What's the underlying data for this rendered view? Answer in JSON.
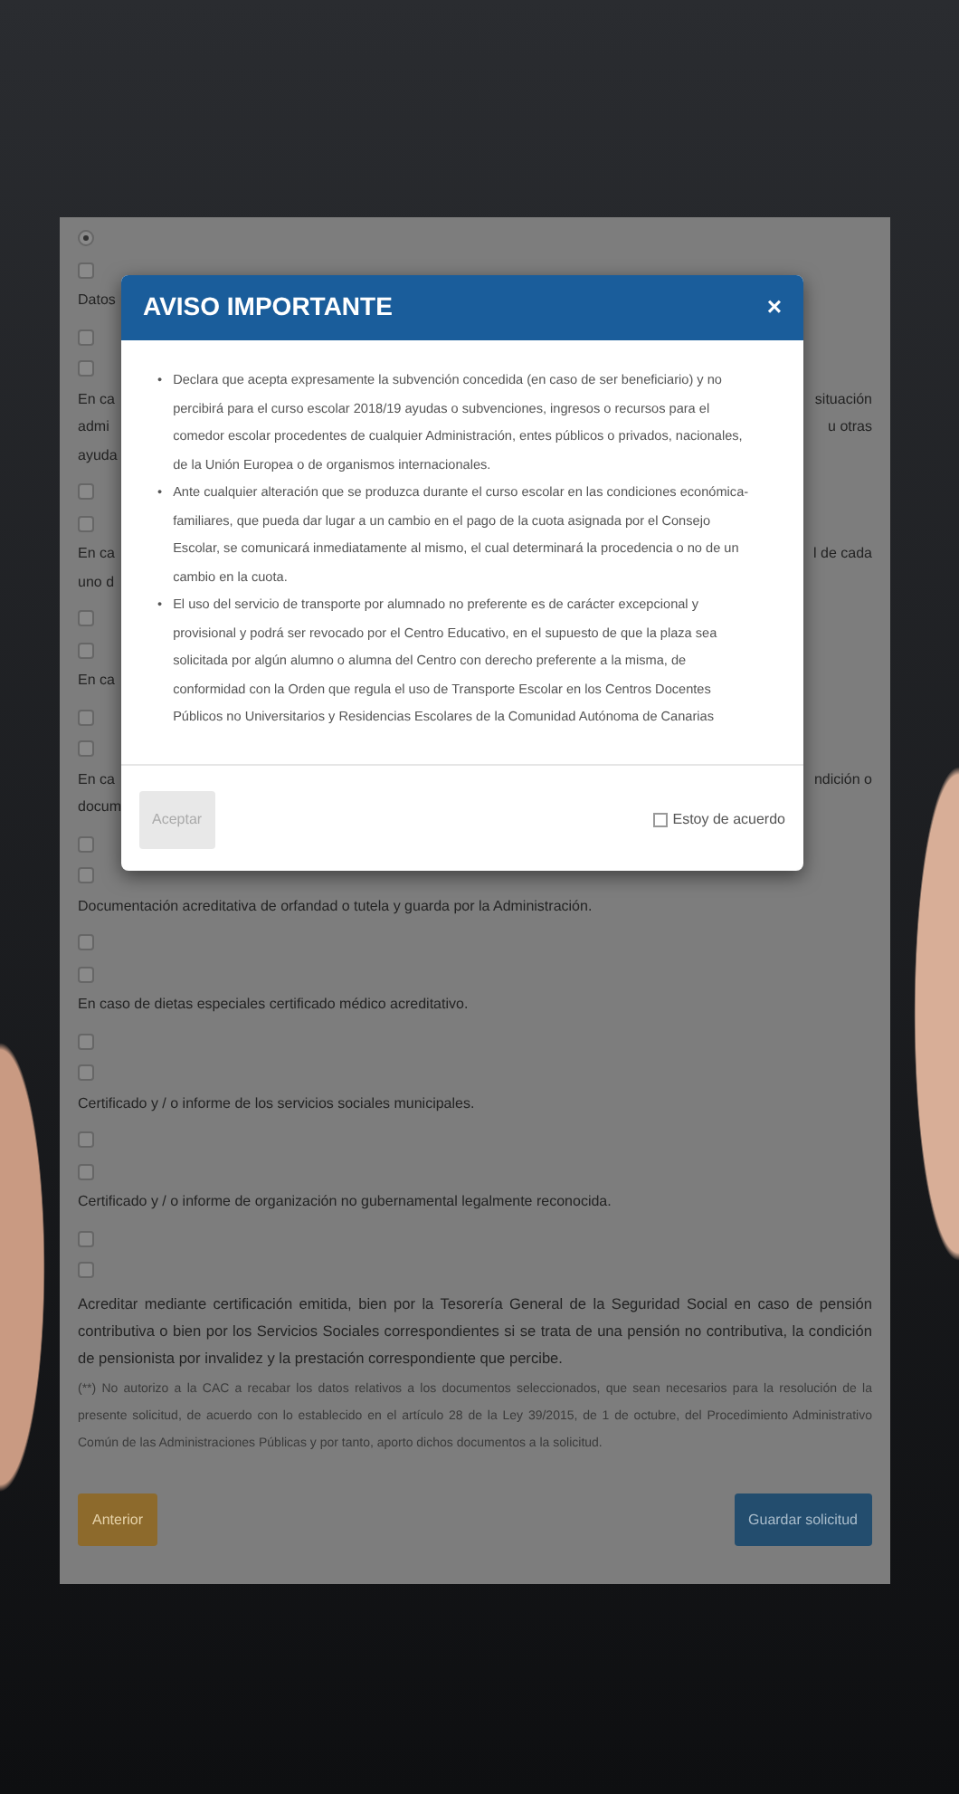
{
  "form": {
    "items": [
      {
        "kind": "radio",
        "checked": true
      },
      {
        "kind": "checkbox",
        "checked": false
      },
      {
        "kind": "text",
        "lines": [
          {
            "left": "Datos"
          }
        ]
      },
      {
        "kind": "checkbox",
        "checked": false
      },
      {
        "kind": "checkbox",
        "checked": false
      },
      {
        "kind": "text",
        "lines": [
          {
            "left": "En ca",
            "right": "situación"
          },
          {
            "left": "admi",
            "right": "u otras"
          },
          {
            "left": "ayuda"
          }
        ]
      },
      {
        "kind": "checkbox",
        "checked": false
      },
      {
        "kind": "checkbox",
        "checked": false
      },
      {
        "kind": "text",
        "lines": [
          {
            "left": "En ca",
            "right": "l de cada"
          },
          {
            "left": "uno d"
          }
        ]
      },
      {
        "kind": "checkbox",
        "checked": false
      },
      {
        "kind": "checkbox",
        "checked": false
      },
      {
        "kind": "text",
        "lines": [
          {
            "left": "En ca"
          }
        ]
      },
      {
        "kind": "checkbox",
        "checked": false
      },
      {
        "kind": "checkbox",
        "checked": false
      },
      {
        "kind": "text",
        "lines": [
          {
            "left": "En ca",
            "right": "ndición o"
          },
          {
            "left": "docum"
          }
        ]
      },
      {
        "kind": "checkbox",
        "checked": false
      },
      {
        "kind": "checkbox",
        "checked": false
      },
      {
        "kind": "text",
        "lines": [
          {
            "left": "Documentación acreditativa de orfandad o tutela y guarda por la Administración."
          }
        ]
      },
      {
        "kind": "checkbox",
        "checked": false
      },
      {
        "kind": "checkbox",
        "checked": false
      },
      {
        "kind": "text",
        "lines": [
          {
            "left": "En caso de dietas especiales certificado médico acreditativo."
          }
        ]
      },
      {
        "kind": "checkbox",
        "checked": false
      },
      {
        "kind": "checkbox",
        "checked": false
      },
      {
        "kind": "text",
        "lines": [
          {
            "left": "Certificado y / o informe de los servicios sociales municipales."
          }
        ]
      },
      {
        "kind": "checkbox",
        "checked": false
      },
      {
        "kind": "checkbox",
        "checked": false
      },
      {
        "kind": "text",
        "lines": [
          {
            "left": "Certificado y / o informe de organización no gubernamental legalmente reconocida."
          }
        ]
      },
      {
        "kind": "checkbox",
        "checked": false
      },
      {
        "kind": "checkbox",
        "checked": false
      },
      {
        "kind": "paragraph",
        "text": "Acreditar mediante certificación emitida, bien por la Tesorería General de la Seguridad Social en caso de pensión contributiva o bien por los Servicios Sociales correspondientes si se trata de una pensión no contributiva, la condición de pensionista por invalidez y la prestación correspondiente que percibe."
      },
      {
        "kind": "note",
        "text": "(**) No autorizo a la CAC a recabar los datos relativos a los documentos seleccionados, que sean necesarios para la resolución de la presente solicitud, de acuerdo con lo establecido en el artículo 28 de la Ley 39/2015, de 1 de octubre, del Procedimiento Administrativo Común de las Administraciones Públicas y por tanto, aporto dichos documentos a la solicitud."
      }
    ],
    "buttons": [
      {
        "label": "Anterior",
        "kind": "warning"
      },
      {
        "label": "Guardar solicitud",
        "kind": "primary"
      }
    ]
  },
  "modal": {
    "title": "AVISO IMPORTANTE",
    "close": "×",
    "bullet": "•",
    "items": [
      "Declara que acepta expresamente la subvención concedida (en caso de ser beneficiario) y no percibirá para el curso escolar 2018/19 ayudas o subvenciones, ingresos o recursos para el comedor escolar procedentes de cualquier Administración, entes públicos o privados, nacionales, de la Unión Europea o de organismos internacionales.",
      "Ante cualquier alteración que se produzca durante el curso escolar en las condiciones económica-familiares, que pueda dar lugar a un cambio en el pago de la cuota asignada por el Consejo Escolar, se comunicará inmediatamente al mismo, el cual determinará la procedencia o no de un cambio en la cuota.",
      "El uso del servicio de transporte por alumnado no preferente es de carácter excepcional y provisional y podrá ser revocado por el Centro Educativo, en el supuesto de que la plaza sea solicitada por algún alumno o alumna del Centro con derecho preferente a la misma, de conformidad con la Orden que regula el uso de Transporte Escolar en los Centros Docentes Públicos no Universitarios y Residencias Escolares de la Comunidad Autónoma de Canarias"
    ],
    "accept": {
      "label": "Aceptar",
      "disabled": true
    },
    "agree": {
      "label": "Estoy de acuerdo",
      "checked": false
    }
  }
}
